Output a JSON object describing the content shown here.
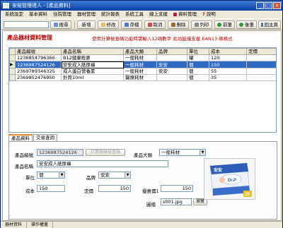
{
  "window": {
    "title": "安裕管理達人 - [產品資料]"
  },
  "menu": [
    "系統設定",
    "基本資料",
    "住院管理",
    "器材管理",
    "統計報表",
    "系統工具",
    "線上支援",
    "資料管理",
    "說明"
  ],
  "toolbar": {
    "search_label": "搜尋",
    "new_label": "新增",
    "edit_label": "修改",
    "save_label": "存檔",
    "cancel_label": "取消",
    "delete_label": "刪除",
    "print_label": "列印",
    "first_label": "前筆",
    "next_label": "後筆",
    "home_label": "回主頁",
    "exit_label": "離開"
  },
  "page": {
    "title": "產品器材資料管理",
    "note": "使用計算檢查碼功能時需輸入12碼數字 此功能僅支援 EAN13 碼格式"
  },
  "grid": {
    "columns": [
      "產品編號",
      "產品名稱",
      "產品大類",
      "品牌",
      "單位",
      "成本",
      "定價"
    ],
    "rows": [
      [
        "1236854796366",
        "B12健康殺麥",
        "一般耗材",
        "",
        "罐",
        "120",
        ""
      ],
      [
        "1236987524126",
        "安安成人紙尿褲",
        "一般耗材",
        "安安",
        "個",
        "150",
        ""
      ],
      [
        "2369789346325",
        "成人蛋白營養素",
        "一般耗材",
        "安安",
        "個",
        "55",
        ""
      ],
      [
        "2369852476950",
        "針筒10ml",
        "醫療耗材",
        "",
        "個",
        "35",
        ""
      ]
    ],
    "selected_index": 1
  },
  "tabs": [
    {
      "label": "產品資料"
    },
    {
      "label": "交易查詢"
    }
  ],
  "form": {
    "code_label": "產品編號",
    "code_value": "1236987524126",
    "check_button": "計算條碼檢查碼",
    "category_label": "產品大類",
    "category_value": "一般耗材",
    "name_label": "產品名稱",
    "name_value": "安安成人紙尿褲",
    "unit_label": "單位",
    "unit_value": "個",
    "brand_label": "品牌",
    "brand_value": "安安",
    "cost_label": "成本",
    "cost_value": "150",
    "price_label": "定價",
    "price_value": "150",
    "promo_label": "優惠價1",
    "promo_value": "150",
    "image_label": "圖檔",
    "image_value": "s001.jpg",
    "browse_button": "瀏覽"
  },
  "product_image": {
    "brand": "安安",
    "sub": "Dr.P",
    "count": "20"
  },
  "status": [
    "器材資料",
    "操作權量"
  ]
}
